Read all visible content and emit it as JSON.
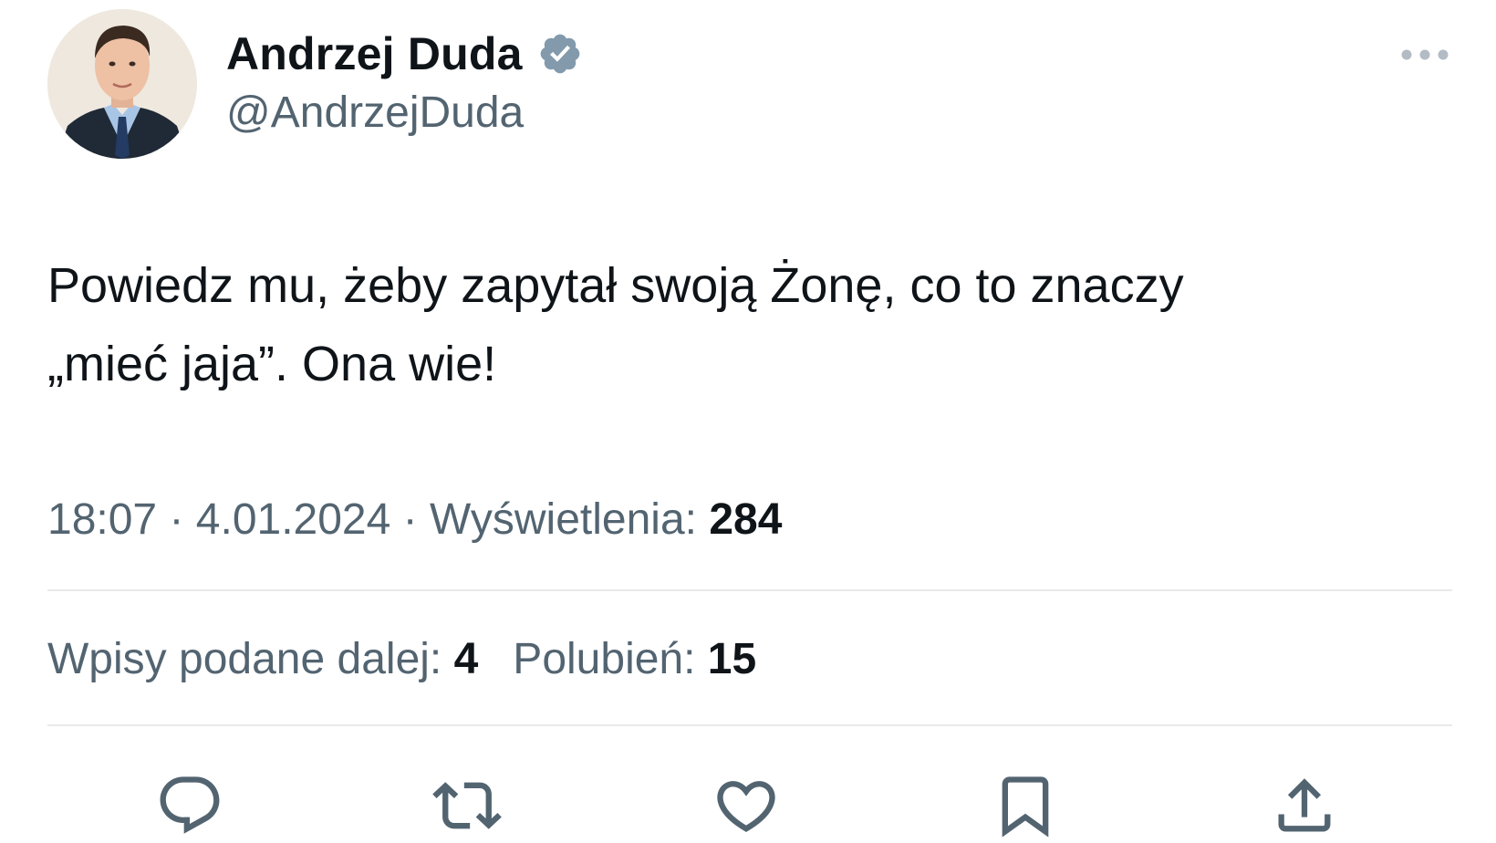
{
  "author": {
    "display_name": "Andrzej Duda",
    "handle": "@AndrzejDuda",
    "verified_icon": "verified-badge-icon",
    "verified_color": "#829aab"
  },
  "tweet": {
    "text": "Powiedz mu, żeby zapytał swoją Żonę, co to znaczy\n„mieć jaja”. Ona wie!"
  },
  "meta": {
    "time": "18:07",
    "separator": " · ",
    "date": "4.01.2024",
    "views_label": "Wyświetlenia: ",
    "views_count": "284"
  },
  "stats": {
    "reposts_label": "Wpisy podane dalej: ",
    "reposts_count": "4",
    "likes_label": "Polubień: ",
    "likes_count": "15"
  },
  "actions": [
    {
      "icon": "reply-icon"
    },
    {
      "icon": "repost-icon"
    },
    {
      "icon": "like-icon"
    },
    {
      "icon": "bookmark-icon"
    },
    {
      "icon": "share-icon"
    }
  ],
  "colors": {
    "text_primary": "#0f1419",
    "text_secondary": "#536471",
    "divider": "#e7e9ea",
    "icon_gray": "#536471"
  }
}
